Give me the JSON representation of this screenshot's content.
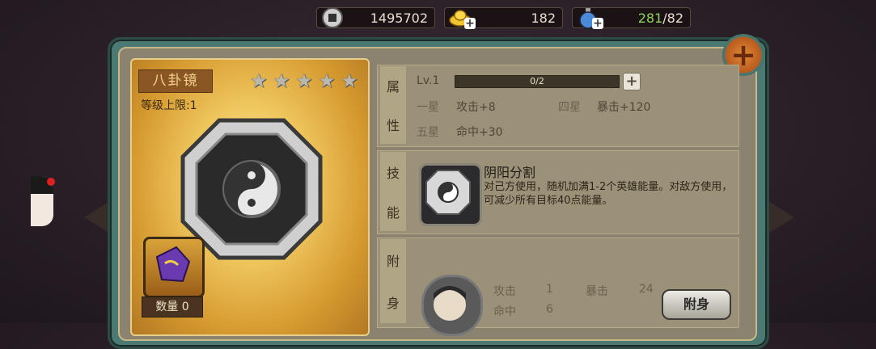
{
  "resources": {
    "coin": {
      "icon": "silver-coin-icon",
      "value": "1495702"
    },
    "gold": {
      "icon": "gold-ingot-icon",
      "value": "182"
    },
    "stamina": {
      "icon": "potion-icon",
      "current": "281",
      "max": "/82"
    }
  },
  "equipment": {
    "name": "八卦镜",
    "level_cap": "等级上限:1",
    "stars": 5,
    "material_quantity": "数量 0"
  },
  "attributes": {
    "tab_label_top": "属",
    "tab_label_bottom": "性",
    "level": "Lv.1",
    "progress_text": "0/2",
    "progress_fraction": 0,
    "lines": [
      {
        "label": "一星",
        "value": "攻击+8"
      },
      {
        "label": "四星",
        "value": "暴击+120"
      },
      {
        "label": "五星",
        "value": "命中+30"
      }
    ]
  },
  "skill": {
    "tab_label_top": "技",
    "tab_label_bottom": "能",
    "title": "阴阳分割",
    "description": "对己方使用，随机加满1-2个英雄能量。对敌方使用，可减少所有目标40点能量。"
  },
  "attach": {
    "tab_label_top": "附",
    "tab_label_bottom": "身",
    "stats": [
      {
        "label": "攻击",
        "value": "1"
      },
      {
        "label": "暴击",
        "value": "24"
      },
      {
        "label": "命中",
        "value": "6"
      }
    ],
    "button_label": "附身"
  },
  "colors": {
    "frame": "#4a7a72",
    "progress_bg": "#3c3628",
    "green_text": "#8ed35c"
  }
}
